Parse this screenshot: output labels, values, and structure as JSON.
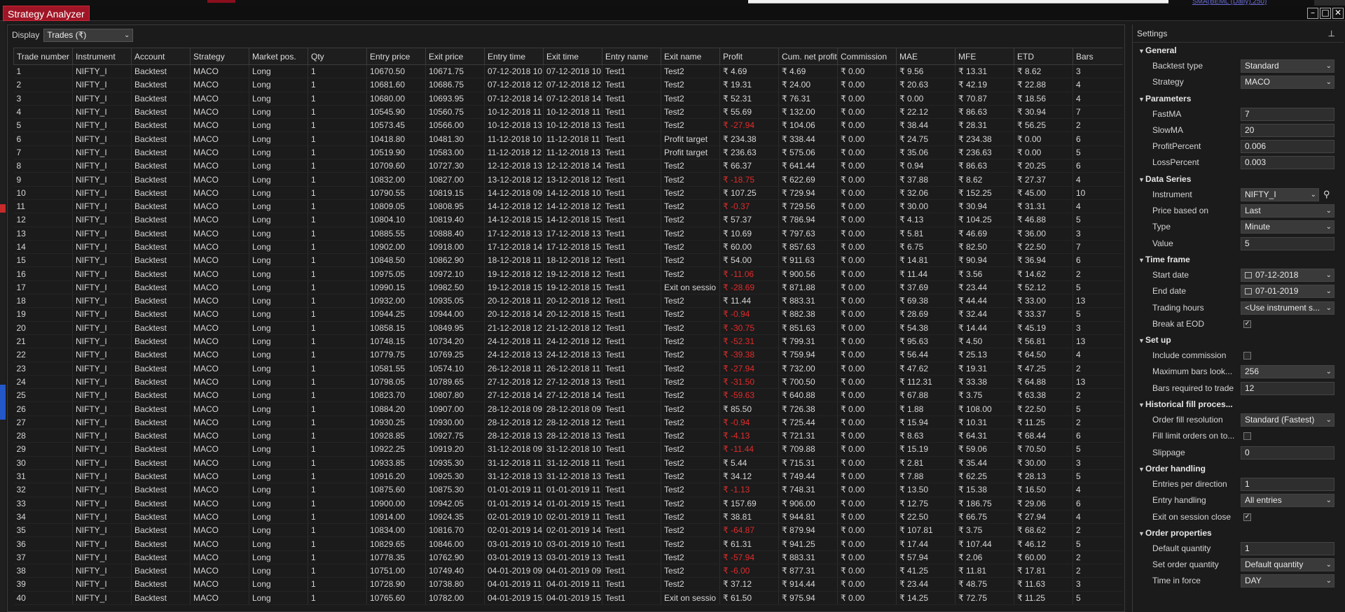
{
  "window": {
    "title": "Strategy Analyzer",
    "indicator_fragment": "SMA(BEML (Daily),250)"
  },
  "display": {
    "label": "Display",
    "selected": "Trades (₹)"
  },
  "table": {
    "columns": [
      "Trade number",
      "Instrument",
      "Account",
      "Strategy",
      "Market pos.",
      "Qty",
      "Entry price",
      "Exit price",
      "Entry time",
      "Exit time",
      "Entry name",
      "Exit name",
      "Profit",
      "Cum. net profit",
      "Commission",
      "MAE",
      "MFE",
      "ETD",
      "Bars"
    ],
    "rows": [
      [
        "1",
        "NIFTY_I",
        "Backtest",
        "MACO",
        "Long",
        "1",
        "10670.50",
        "10671.75",
        "07-12-2018 10",
        "07-12-2018 10",
        "Test1",
        "Test2",
        "₹ 4.69",
        "₹ 4.69",
        "₹ 0.00",
        "₹ 9.56",
        "₹ 13.31",
        "₹ 8.62",
        "3"
      ],
      [
        "2",
        "NIFTY_I",
        "Backtest",
        "MACO",
        "Long",
        "1",
        "10681.60",
        "10686.75",
        "07-12-2018 12",
        "07-12-2018 12",
        "Test1",
        "Test2",
        "₹ 19.31",
        "₹ 24.00",
        "₹ 0.00",
        "₹ 20.63",
        "₹ 42.19",
        "₹ 22.88",
        "4"
      ],
      [
        "3",
        "NIFTY_I",
        "Backtest",
        "MACO",
        "Long",
        "1",
        "10680.00",
        "10693.95",
        "07-12-2018 14",
        "07-12-2018 14",
        "Test1",
        "Test2",
        "₹ 52.31",
        "₹ 76.31",
        "₹ 0.00",
        "₹ 0.00",
        "₹ 70.87",
        "₹ 18.56",
        "4"
      ],
      [
        "4",
        "NIFTY_I",
        "Backtest",
        "MACO",
        "Long",
        "1",
        "10545.90",
        "10560.75",
        "10-12-2018 11",
        "10-12-2018 11",
        "Test1",
        "Test2",
        "₹ 55.69",
        "₹ 132.00",
        "₹ 0.00",
        "₹ 22.12",
        "₹ 86.63",
        "₹ 30.94",
        "7"
      ],
      [
        "5",
        "NIFTY_I",
        "Backtest",
        "MACO",
        "Long",
        "1",
        "10573.45",
        "10566.00",
        "10-12-2018 13",
        "10-12-2018 13",
        "Test1",
        "Test2",
        "₹ -27.94",
        "₹ 104.06",
        "₹ 0.00",
        "₹ 38.44",
        "₹ 28.31",
        "₹ 56.25",
        "2"
      ],
      [
        "6",
        "NIFTY_I",
        "Backtest",
        "MACO",
        "Long",
        "1",
        "10418.80",
        "10481.30",
        "11-12-2018 10",
        "11-12-2018 11",
        "Test1",
        "Profit target",
        "₹ 234.38",
        "₹ 338.44",
        "₹ 0.00",
        "₹ 24.75",
        "₹ 234.38",
        "₹ 0.00",
        "6"
      ],
      [
        "7",
        "NIFTY_I",
        "Backtest",
        "MACO",
        "Long",
        "1",
        "10519.90",
        "10583.00",
        "11-12-2018 12",
        "11-12-2018 13",
        "Test1",
        "Profit target",
        "₹ 236.63",
        "₹ 575.06",
        "₹ 0.00",
        "₹ 35.06",
        "₹ 236.63",
        "₹ 0.00",
        "5"
      ],
      [
        "8",
        "NIFTY_I",
        "Backtest",
        "MACO",
        "Long",
        "1",
        "10709.60",
        "10727.30",
        "12-12-2018 13",
        "12-12-2018 14",
        "Test1",
        "Test2",
        "₹ 66.37",
        "₹ 641.44",
        "₹ 0.00",
        "₹ 0.94",
        "₹ 86.63",
        "₹ 20.25",
        "6"
      ],
      [
        "9",
        "NIFTY_I",
        "Backtest",
        "MACO",
        "Long",
        "1",
        "10832.00",
        "10827.00",
        "13-12-2018 12",
        "13-12-2018 12",
        "Test1",
        "Test2",
        "₹ -18.75",
        "₹ 622.69",
        "₹ 0.00",
        "₹ 37.88",
        "₹ 8.62",
        "₹ 27.37",
        "4"
      ],
      [
        "10",
        "NIFTY_I",
        "Backtest",
        "MACO",
        "Long",
        "1",
        "10790.55",
        "10819.15",
        "14-12-2018 09",
        "14-12-2018 10",
        "Test1",
        "Test2",
        "₹ 107.25",
        "₹ 729.94",
        "₹ 0.00",
        "₹ 32.06",
        "₹ 152.25",
        "₹ 45.00",
        "10"
      ],
      [
        "11",
        "NIFTY_I",
        "Backtest",
        "MACO",
        "Long",
        "1",
        "10809.05",
        "10808.95",
        "14-12-2018 12",
        "14-12-2018 12",
        "Test1",
        "Test2",
        "₹ -0.37",
        "₹ 729.56",
        "₹ 0.00",
        "₹ 30.00",
        "₹ 30.94",
        "₹ 31.31",
        "4"
      ],
      [
        "12",
        "NIFTY_I",
        "Backtest",
        "MACO",
        "Long",
        "1",
        "10804.10",
        "10819.40",
        "14-12-2018 15",
        "14-12-2018 15",
        "Test1",
        "Test2",
        "₹ 57.37",
        "₹ 786.94",
        "₹ 0.00",
        "₹ 4.13",
        "₹ 104.25",
        "₹ 46.88",
        "5"
      ],
      [
        "13",
        "NIFTY_I",
        "Backtest",
        "MACO",
        "Long",
        "1",
        "10885.55",
        "10888.40",
        "17-12-2018 13",
        "17-12-2018 13",
        "Test1",
        "Test2",
        "₹ 10.69",
        "₹ 797.63",
        "₹ 0.00",
        "₹ 5.81",
        "₹ 46.69",
        "₹ 36.00",
        "3"
      ],
      [
        "14",
        "NIFTY_I",
        "Backtest",
        "MACO",
        "Long",
        "1",
        "10902.00",
        "10918.00",
        "17-12-2018 14",
        "17-12-2018 15",
        "Test1",
        "Test2",
        "₹ 60.00",
        "₹ 857.63",
        "₹ 0.00",
        "₹ 6.75",
        "₹ 82.50",
        "₹ 22.50",
        "7"
      ],
      [
        "15",
        "NIFTY_I",
        "Backtest",
        "MACO",
        "Long",
        "1",
        "10848.50",
        "10862.90",
        "18-12-2018 11",
        "18-12-2018 12",
        "Test1",
        "Test2",
        "₹ 54.00",
        "₹ 911.63",
        "₹ 0.00",
        "₹ 14.81",
        "₹ 90.94",
        "₹ 36.94",
        "6"
      ],
      [
        "16",
        "NIFTY_I",
        "Backtest",
        "MACO",
        "Long",
        "1",
        "10975.05",
        "10972.10",
        "19-12-2018 12",
        "19-12-2018 12",
        "Test1",
        "Test2",
        "₹ -11.06",
        "₹ 900.56",
        "₹ 0.00",
        "₹ 11.44",
        "₹ 3.56",
        "₹ 14.62",
        "2"
      ],
      [
        "17",
        "NIFTY_I",
        "Backtest",
        "MACO",
        "Long",
        "1",
        "10990.15",
        "10982.50",
        "19-12-2018 15",
        "19-12-2018 15",
        "Test1",
        "Exit on sessio",
        "₹ -28.69",
        "₹ 871.88",
        "₹ 0.00",
        "₹ 37.69",
        "₹ 23.44",
        "₹ 52.12",
        "5"
      ],
      [
        "18",
        "NIFTY_I",
        "Backtest",
        "MACO",
        "Long",
        "1",
        "10932.00",
        "10935.05",
        "20-12-2018 11",
        "20-12-2018 12",
        "Test1",
        "Test2",
        "₹ 11.44",
        "₹ 883.31",
        "₹ 0.00",
        "₹ 69.38",
        "₹ 44.44",
        "₹ 33.00",
        "13"
      ],
      [
        "19",
        "NIFTY_I",
        "Backtest",
        "MACO",
        "Long",
        "1",
        "10944.25",
        "10944.00",
        "20-12-2018 14",
        "20-12-2018 15",
        "Test1",
        "Test2",
        "₹ -0.94",
        "₹ 882.38",
        "₹ 0.00",
        "₹ 28.69",
        "₹ 32.44",
        "₹ 33.37",
        "5"
      ],
      [
        "20",
        "NIFTY_I",
        "Backtest",
        "MACO",
        "Long",
        "1",
        "10858.15",
        "10849.95",
        "21-12-2018 12",
        "21-12-2018 12",
        "Test1",
        "Test2",
        "₹ -30.75",
        "₹ 851.63",
        "₹ 0.00",
        "₹ 54.38",
        "₹ 14.44",
        "₹ 45.19",
        "3"
      ],
      [
        "21",
        "NIFTY_I",
        "Backtest",
        "MACO",
        "Long",
        "1",
        "10748.15",
        "10734.20",
        "24-12-2018 11",
        "24-12-2018 12",
        "Test1",
        "Test2",
        "₹ -52.31",
        "₹ 799.31",
        "₹ 0.00",
        "₹ 95.63",
        "₹ 4.50",
        "₹ 56.81",
        "13"
      ],
      [
        "22",
        "NIFTY_I",
        "Backtest",
        "MACO",
        "Long",
        "1",
        "10779.75",
        "10769.25",
        "24-12-2018 13",
        "24-12-2018 13",
        "Test1",
        "Test2",
        "₹ -39.38",
        "₹ 759.94",
        "₹ 0.00",
        "₹ 56.44",
        "₹ 25.13",
        "₹ 64.50",
        "4"
      ],
      [
        "23",
        "NIFTY_I",
        "Backtest",
        "MACO",
        "Long",
        "1",
        "10581.55",
        "10574.10",
        "26-12-2018 11",
        "26-12-2018 11",
        "Test1",
        "Test2",
        "₹ -27.94",
        "₹ 732.00",
        "₹ 0.00",
        "₹ 47.62",
        "₹ 19.31",
        "₹ 47.25",
        "2"
      ],
      [
        "24",
        "NIFTY_I",
        "Backtest",
        "MACO",
        "Long",
        "1",
        "10798.05",
        "10789.65",
        "27-12-2018 12",
        "27-12-2018 13",
        "Test1",
        "Test2",
        "₹ -31.50",
        "₹ 700.50",
        "₹ 0.00",
        "₹ 112.31",
        "₹ 33.38",
        "₹ 64.88",
        "13"
      ],
      [
        "25",
        "NIFTY_I",
        "Backtest",
        "MACO",
        "Long",
        "1",
        "10823.70",
        "10807.80",
        "27-12-2018 14",
        "27-12-2018 14",
        "Test1",
        "Test2",
        "₹ -59.63",
        "₹ 640.88",
        "₹ 0.00",
        "₹ 67.88",
        "₹ 3.75",
        "₹ 63.38",
        "2"
      ],
      [
        "26",
        "NIFTY_I",
        "Backtest",
        "MACO",
        "Long",
        "1",
        "10884.20",
        "10907.00",
        "28-12-2018 09",
        "28-12-2018 09",
        "Test1",
        "Test2",
        "₹ 85.50",
        "₹ 726.38",
        "₹ 0.00",
        "₹ 1.88",
        "₹ 108.00",
        "₹ 22.50",
        "5"
      ],
      [
        "27",
        "NIFTY_I",
        "Backtest",
        "MACO",
        "Long",
        "1",
        "10930.25",
        "10930.00",
        "28-12-2018 12",
        "28-12-2018 12",
        "Test1",
        "Test2",
        "₹ -0.94",
        "₹ 725.44",
        "₹ 0.00",
        "₹ 15.94",
        "₹ 10.31",
        "₹ 11.25",
        "2"
      ],
      [
        "28",
        "NIFTY_I",
        "Backtest",
        "MACO",
        "Long",
        "1",
        "10928.85",
        "10927.75",
        "28-12-2018 13",
        "28-12-2018 13",
        "Test1",
        "Test2",
        "₹ -4.13",
        "₹ 721.31",
        "₹ 0.00",
        "₹ 8.63",
        "₹ 64.31",
        "₹ 68.44",
        "6"
      ],
      [
        "29",
        "NIFTY_I",
        "Backtest",
        "MACO",
        "Long",
        "1",
        "10922.25",
        "10919.20",
        "31-12-2018 09",
        "31-12-2018 10",
        "Test1",
        "Test2",
        "₹ -11.44",
        "₹ 709.88",
        "₹ 0.00",
        "₹ 15.19",
        "₹ 59.06",
        "₹ 70.50",
        "5"
      ],
      [
        "30",
        "NIFTY_I",
        "Backtest",
        "MACO",
        "Long",
        "1",
        "10933.85",
        "10935.30",
        "31-12-2018 11",
        "31-12-2018 11",
        "Test1",
        "Test2",
        "₹ 5.44",
        "₹ 715.31",
        "₹ 0.00",
        "₹ 2.81",
        "₹ 35.44",
        "₹ 30.00",
        "3"
      ],
      [
        "31",
        "NIFTY_I",
        "Backtest",
        "MACO",
        "Long",
        "1",
        "10916.20",
        "10925.30",
        "31-12-2018 13",
        "31-12-2018 13",
        "Test1",
        "Test2",
        "₹ 34.12",
        "₹ 749.44",
        "₹ 0.00",
        "₹ 7.88",
        "₹ 62.25",
        "₹ 28.13",
        "5"
      ],
      [
        "32",
        "NIFTY_I",
        "Backtest",
        "MACO",
        "Long",
        "1",
        "10875.60",
        "10875.30",
        "01-01-2019 11",
        "01-01-2019 11",
        "Test1",
        "Test2",
        "₹ -1.13",
        "₹ 748.31",
        "₹ 0.00",
        "₹ 13.50",
        "₹ 15.38",
        "₹ 16.50",
        "4"
      ],
      [
        "33",
        "NIFTY_I",
        "Backtest",
        "MACO",
        "Long",
        "1",
        "10900.00",
        "10942.05",
        "01-01-2019 14",
        "01-01-2019 15",
        "Test1",
        "Test2",
        "₹ 157.69",
        "₹ 906.00",
        "₹ 0.00",
        "₹ 12.75",
        "₹ 186.75",
        "₹ 29.06",
        "6"
      ],
      [
        "34",
        "NIFTY_I",
        "Backtest",
        "MACO",
        "Long",
        "1",
        "10914.00",
        "10924.35",
        "02-01-2019 10",
        "02-01-2019 11",
        "Test1",
        "Test2",
        "₹ 38.81",
        "₹ 944.81",
        "₹ 0.00",
        "₹ 22.50",
        "₹ 66.75",
        "₹ 27.94",
        "4"
      ],
      [
        "35",
        "NIFTY_I",
        "Backtest",
        "MACO",
        "Long",
        "1",
        "10834.00",
        "10816.70",
        "02-01-2019 14",
        "02-01-2019 14",
        "Test1",
        "Test2",
        "₹ -64.87",
        "₹ 879.94",
        "₹ 0.00",
        "₹ 107.81",
        "₹ 3.75",
        "₹ 68.62",
        "2"
      ],
      [
        "36",
        "NIFTY_I",
        "Backtest",
        "MACO",
        "Long",
        "1",
        "10829.65",
        "10846.00",
        "03-01-2019 10",
        "03-01-2019 10",
        "Test1",
        "Test2",
        "₹ 61.31",
        "₹ 941.25",
        "₹ 0.00",
        "₹ 17.44",
        "₹ 107.44",
        "₹ 46.12",
        "5"
      ],
      [
        "37",
        "NIFTY_I",
        "Backtest",
        "MACO",
        "Long",
        "1",
        "10778.35",
        "10762.90",
        "03-01-2019 13",
        "03-01-2019 13",
        "Test1",
        "Test2",
        "₹ -57.94",
        "₹ 883.31",
        "₹ 0.00",
        "₹ 57.94",
        "₹ 2.06",
        "₹ 60.00",
        "2"
      ],
      [
        "38",
        "NIFTY_I",
        "Backtest",
        "MACO",
        "Long",
        "1",
        "10751.00",
        "10749.40",
        "04-01-2019 09",
        "04-01-2019 09",
        "Test1",
        "Test2",
        "₹ -6.00",
        "₹ 877.31",
        "₹ 0.00",
        "₹ 41.25",
        "₹ 11.81",
        "₹ 17.81",
        "2"
      ],
      [
        "39",
        "NIFTY_I",
        "Backtest",
        "MACO",
        "Long",
        "1",
        "10728.90",
        "10738.80",
        "04-01-2019 11",
        "04-01-2019 11",
        "Test1",
        "Test2",
        "₹ 37.12",
        "₹ 914.44",
        "₹ 0.00",
        "₹ 23.44",
        "₹ 48.75",
        "₹ 11.63",
        "3"
      ],
      [
        "40",
        "NIFTY_I",
        "Backtest",
        "MACO",
        "Long",
        "1",
        "10765.60",
        "10782.00",
        "04-01-2019 15",
        "04-01-2019 15",
        "Test1",
        "Exit on sessio",
        "₹ 61.50",
        "₹ 975.94",
        "₹ 0.00",
        "₹ 14.25",
        "₹ 72.75",
        "₹ 11.25",
        "5"
      ]
    ]
  },
  "settings": {
    "title": "Settings",
    "sections": [
      {
        "name": "General",
        "props": [
          {
            "label": "Backtest type",
            "value": "Standard",
            "kind": "drop"
          },
          {
            "label": "Strategy",
            "value": "MACO",
            "kind": "drop"
          }
        ]
      },
      {
        "name": "Parameters",
        "props": [
          {
            "label": "FastMA",
            "value": "7",
            "kind": "text"
          },
          {
            "label": "SlowMA",
            "value": "20",
            "kind": "text"
          },
          {
            "label": "ProfitPercent",
            "value": "0.006",
            "kind": "text"
          },
          {
            "label": "LossPercent",
            "value": "0.003",
            "kind": "text"
          }
        ]
      },
      {
        "name": "Data Series",
        "props": [
          {
            "label": "Instrument",
            "value": "NIFTY_I",
            "kind": "instrument"
          },
          {
            "label": "Price based on",
            "value": "Last",
            "kind": "drop"
          },
          {
            "label": "Type",
            "value": "Minute",
            "kind": "drop"
          },
          {
            "label": "Value",
            "value": "5",
            "kind": "text"
          }
        ]
      },
      {
        "name": "Time frame",
        "props": [
          {
            "label": "Start date",
            "value": "07-12-2018",
            "kind": "date"
          },
          {
            "label": "End date",
            "value": "07-01-2019",
            "kind": "date"
          },
          {
            "label": "Trading hours",
            "value": "<Use instrument s...",
            "kind": "drop"
          },
          {
            "label": "Break at EOD",
            "value": true,
            "kind": "check"
          }
        ]
      },
      {
        "name": "Set up",
        "props": [
          {
            "label": "Include commission",
            "value": false,
            "kind": "check"
          },
          {
            "label": "Maximum bars look...",
            "value": "256",
            "kind": "drop"
          },
          {
            "label": "Bars required to trade",
            "value": "12",
            "kind": "text"
          }
        ]
      },
      {
        "name": "Historical fill proces...",
        "props": [
          {
            "label": "Order fill resolution",
            "value": "Standard (Fastest)",
            "kind": "drop"
          },
          {
            "label": "Fill limit orders on to...",
            "value": false,
            "kind": "check"
          },
          {
            "label": "Slippage",
            "value": "0",
            "kind": "text"
          }
        ]
      },
      {
        "name": "Order handling",
        "props": [
          {
            "label": "Entries per direction",
            "value": "1",
            "kind": "text"
          },
          {
            "label": "Entry handling",
            "value": "All entries",
            "kind": "drop"
          },
          {
            "label": "Exit on session close",
            "value": true,
            "kind": "check"
          }
        ]
      },
      {
        "name": "Order properties",
        "props": [
          {
            "label": "Default quantity",
            "value": "1",
            "kind": "text"
          },
          {
            "label": "Set order quantity",
            "value": "Default quantity",
            "kind": "drop"
          },
          {
            "label": "Time in force",
            "value": "DAY",
            "kind": "drop"
          }
        ]
      }
    ]
  },
  "colors": {
    "accent": "#a01525",
    "negative": "#e22b2b",
    "background": "#1b1b1b"
  },
  "icons": {
    "chevron": "chevron-down-icon",
    "section": "triangle-down-icon",
    "pin": "pin-icon",
    "search": "search-icon",
    "calendar": "calendar-icon",
    "check": "checkmark-icon",
    "minimize": "minimize-icon",
    "maximize": "maximize-icon",
    "close": "close-icon"
  }
}
